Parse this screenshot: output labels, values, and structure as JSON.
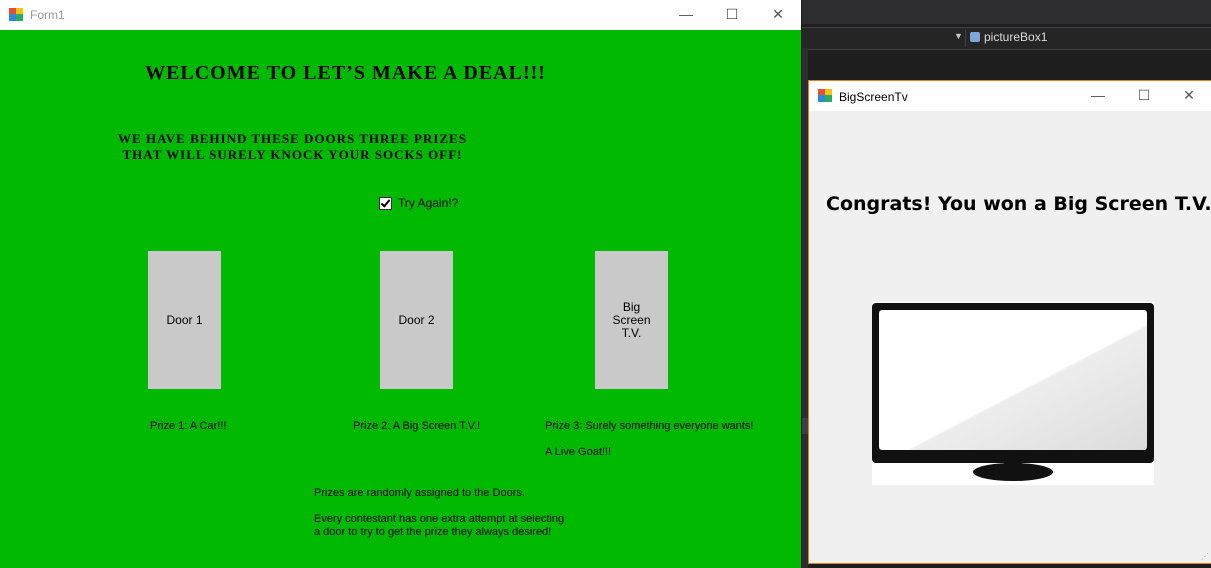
{
  "ide": {
    "object_combo": "pictureBox1"
  },
  "form1": {
    "title": "Form1",
    "heading": "WELCOME TO LET’S MAKE A DEAL!!!",
    "subheading_line1": "WE HAVE BEHIND THESE DOORS THREE PRIZES",
    "subheading_line2": "THAT WILL SURELY KNOCK YOUR SOCKS OFF!",
    "try_again": {
      "label": "Try Again!?",
      "checked": true
    },
    "doors": [
      {
        "label": "Door 1"
      },
      {
        "label": "Door 2"
      },
      {
        "label": "Big Screen T.V."
      }
    ],
    "prizes": {
      "prize1": "Prize 1: A Car!!!",
      "prize2": "Prize 2: A Big Screen T.V.!",
      "prize3": "Prize 3: Surely something everyone wants!",
      "prize3_detail": "A Live Goat!!!"
    },
    "info_line1": "Prizes are randomly assigned to the Doors.",
    "info_line2": "Every contestant has one extra attempt at selecting",
    "info_line3": "a door to try to get the prize they always desired!"
  },
  "tv_window": {
    "title": "BigScreenTv",
    "message": "Congrats! You won a Big Screen T.V.!!!"
  },
  "icons": [
    "app-icon",
    "minimize-icon",
    "maximize-icon",
    "close-icon",
    "checkmark-icon",
    "tv-image"
  ],
  "colors": {
    "form_bg": "#00b900",
    "door_bg": "#c9c9c9",
    "tv_window_border": "#e67e22"
  }
}
